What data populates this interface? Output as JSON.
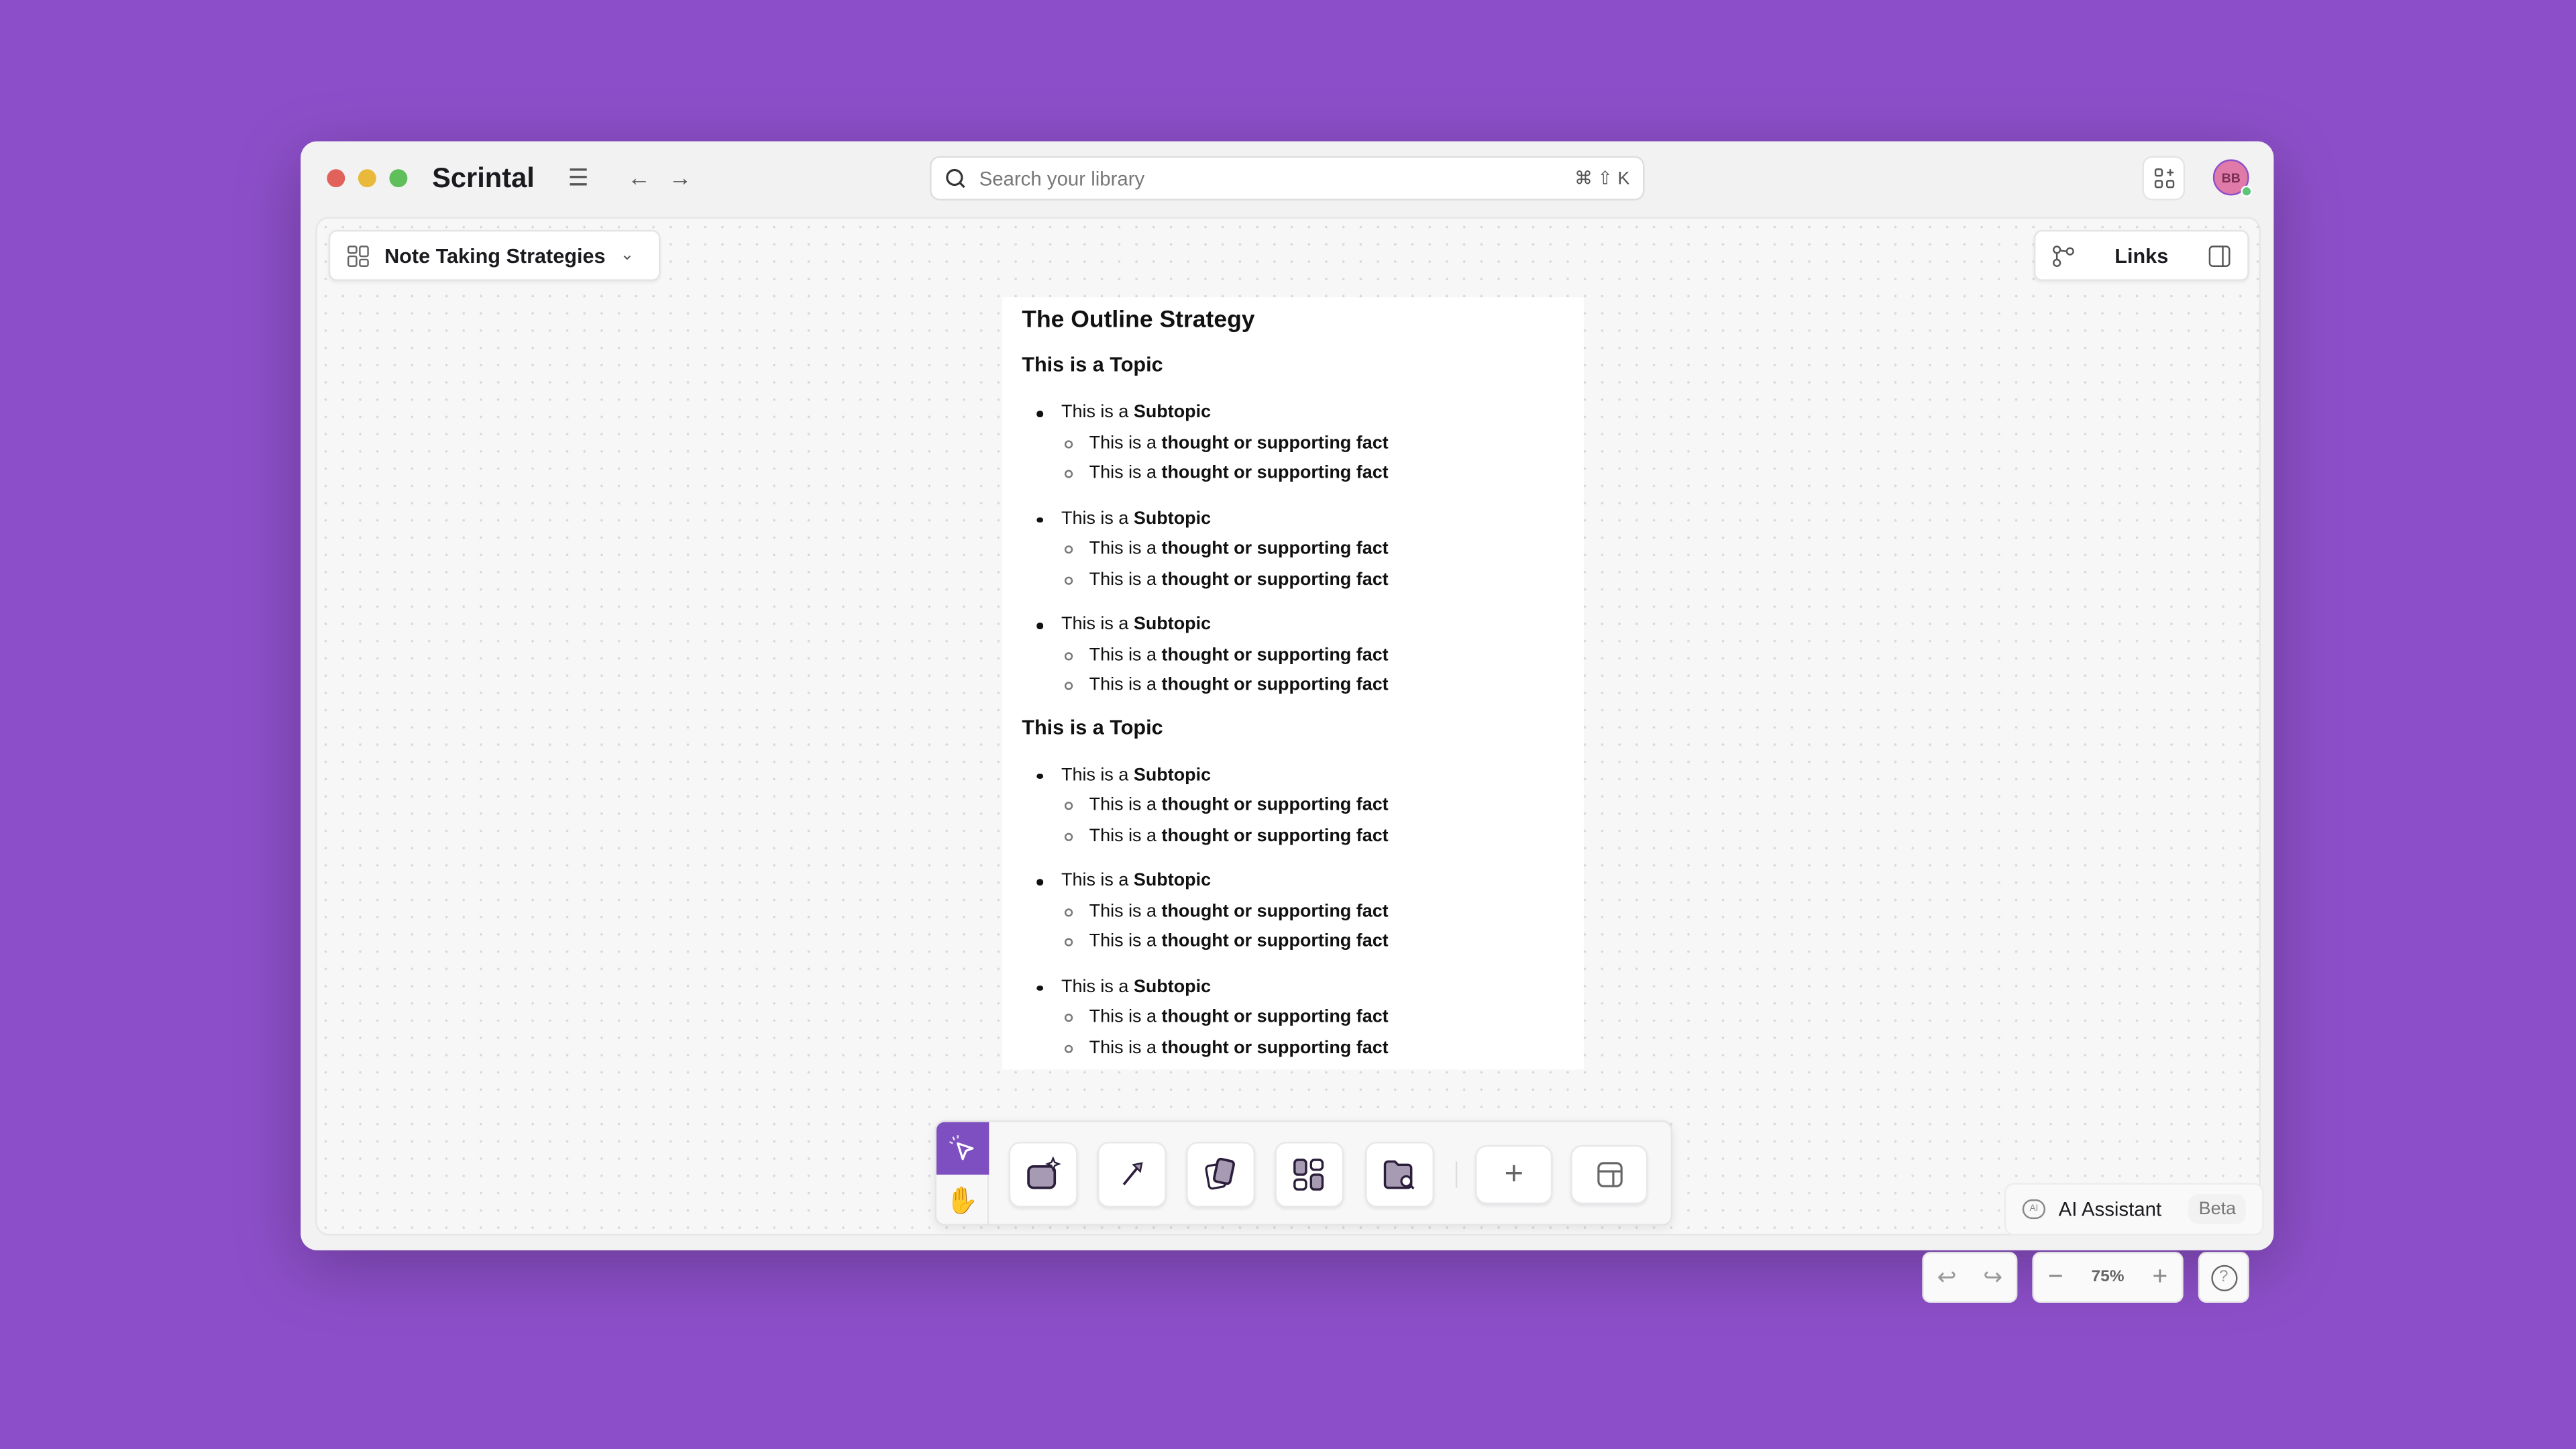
{
  "app": {
    "title": "Scrintal"
  },
  "colors": {
    "accent": "#7e4fc0",
    "background": "#8d4fc9",
    "close": "#e0625a",
    "minimize": "#e9b93c",
    "maximize": "#5fbf5b",
    "avatar": "#e07aa8"
  },
  "search": {
    "placeholder": "Search your library",
    "shortcut": "⌘ ⇧ K"
  },
  "user": {
    "initials": "BB"
  },
  "board": {
    "title": "Note Taking Strategies"
  },
  "links": {
    "label": "Links"
  },
  "document": {
    "title": "The Outline Strategy",
    "topics": [
      {
        "title": "This is a Topic",
        "subtopics": [
          {
            "prefix": "This is a ",
            "bold": "Subtopic",
            "facts": [
              {
                "prefix": "This is a ",
                "bold": "thought or supporting fact"
              },
              {
                "prefix": "This is a ",
                "bold": "thought or supporting fact"
              }
            ]
          },
          {
            "prefix": "This is a ",
            "bold": "Subtopic",
            "facts": [
              {
                "prefix": "This is a ",
                "bold": "thought or supporting fact"
              },
              {
                "prefix": "This is a ",
                "bold": "thought or supporting fact"
              }
            ]
          },
          {
            "prefix": "This is a ",
            "bold": "Subtopic",
            "facts": [
              {
                "prefix": "This is a ",
                "bold": "thought or supporting fact"
              },
              {
                "prefix": "This is a ",
                "bold": "thought or supporting fact"
              }
            ]
          }
        ]
      },
      {
        "title": "This is a Topic",
        "subtopics": [
          {
            "prefix": "This is a ",
            "bold": "Subtopic",
            "facts": [
              {
                "prefix": "This is a ",
                "bold": "thought or supporting fact"
              },
              {
                "prefix": "This is a ",
                "bold": "thought or supporting fact"
              }
            ]
          },
          {
            "prefix": "This is a ",
            "bold": "Subtopic",
            "facts": [
              {
                "prefix": "This is a ",
                "bold": "thought or supporting fact"
              },
              {
                "prefix": "This is a ",
                "bold": "thought or supporting fact"
              }
            ]
          },
          {
            "prefix": "This is a ",
            "bold": "Subtopic",
            "facts": [
              {
                "prefix": "This is a ",
                "bold": "thought or supporting fact"
              },
              {
                "prefix": "This is a ",
                "bold": "thought or supporting fact"
              }
            ]
          }
        ]
      }
    ]
  },
  "ai_assistant": {
    "label": "AI Assistant",
    "badge": "Beta",
    "icon_text": "AI"
  },
  "zoom": {
    "level": "75%"
  },
  "help": {
    "icon_text": "?"
  }
}
